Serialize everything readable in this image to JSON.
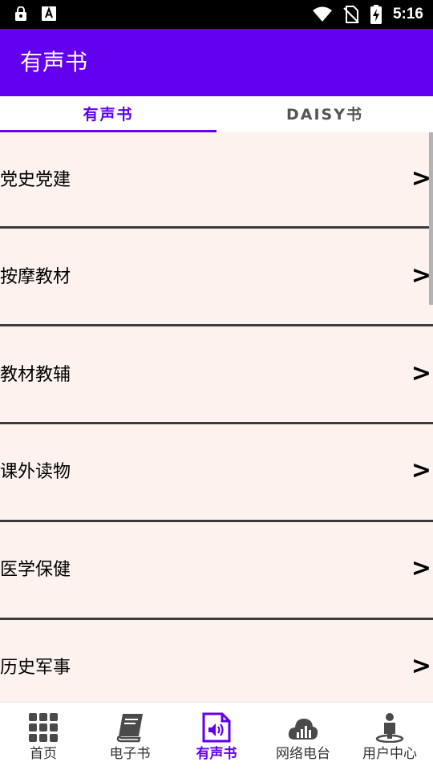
{
  "status_bar": {
    "time": "5:16",
    "icons": [
      "lock-icon",
      "font-a-icon",
      "wifi-icon",
      "no-sim-icon",
      "battery-charging-icon"
    ]
  },
  "app_bar": {
    "title": "有声书"
  },
  "tabs": [
    {
      "label": "有声书",
      "selected": true
    },
    {
      "label": "DAISY书",
      "selected": false
    }
  ],
  "list": {
    "arrow": ">",
    "items": [
      {
        "label": "党史党建"
      },
      {
        "label": "按摩教材"
      },
      {
        "label": "教材教辅"
      },
      {
        "label": "课外读物"
      },
      {
        "label": "医学保健"
      },
      {
        "label": "历史军事"
      }
    ]
  },
  "bottom_nav": {
    "items": [
      {
        "label": "首页",
        "icon": "grid-icon",
        "active": false
      },
      {
        "label": "电子书",
        "icon": "book-icon",
        "active": false
      },
      {
        "label": "有声书",
        "icon": "audio-book-icon",
        "active": true
      },
      {
        "label": "网络电台",
        "icon": "cloud-signal-icon",
        "active": false
      },
      {
        "label": "用户中心",
        "icon": "user-icon",
        "active": false
      }
    ]
  },
  "colors": {
    "primary": "#6200ee",
    "list_background": "#fdf2ee",
    "divider": "#3b3b3b",
    "nav_icon": "#4a4a4a"
  }
}
